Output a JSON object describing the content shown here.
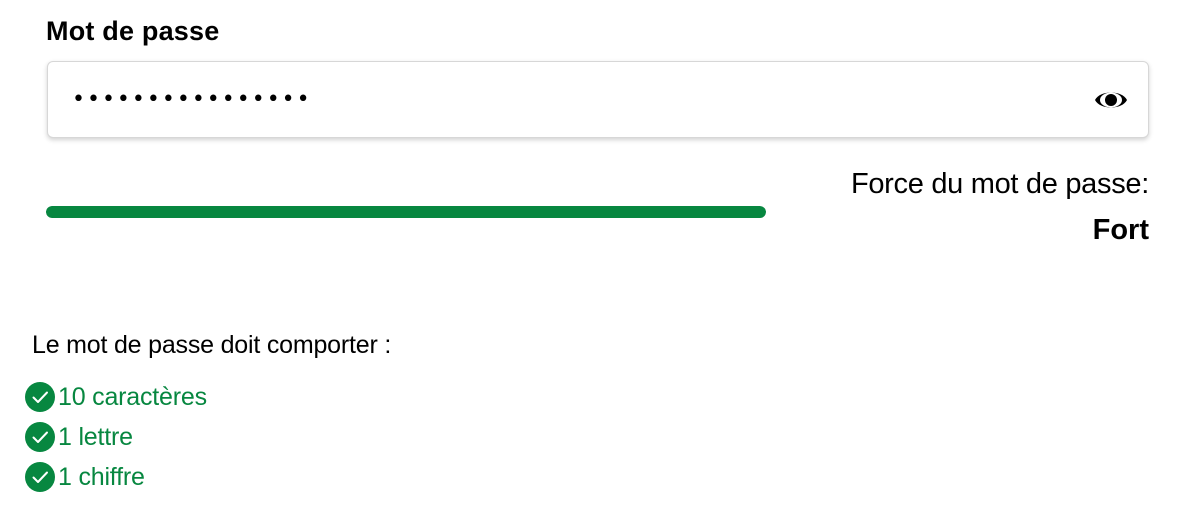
{
  "password": {
    "label": "Mot de passe",
    "masked_value": "••••••••••••••••",
    "toggle_icon": "eye-icon"
  },
  "strength": {
    "label": "Force du mot de passe:",
    "value": "Fort",
    "level": 1.0,
    "color": "#078740"
  },
  "rules": {
    "title": "Le mot de passe doit comporter :",
    "items": [
      {
        "label": "10 caractères",
        "met": true,
        "icon": "check-circle-icon"
      },
      {
        "label": "1 lettre",
        "met": true,
        "icon": "check-circle-icon"
      },
      {
        "label": "1 chiffre",
        "met": true,
        "icon": "check-circle-icon"
      }
    ],
    "color": "#078740"
  }
}
